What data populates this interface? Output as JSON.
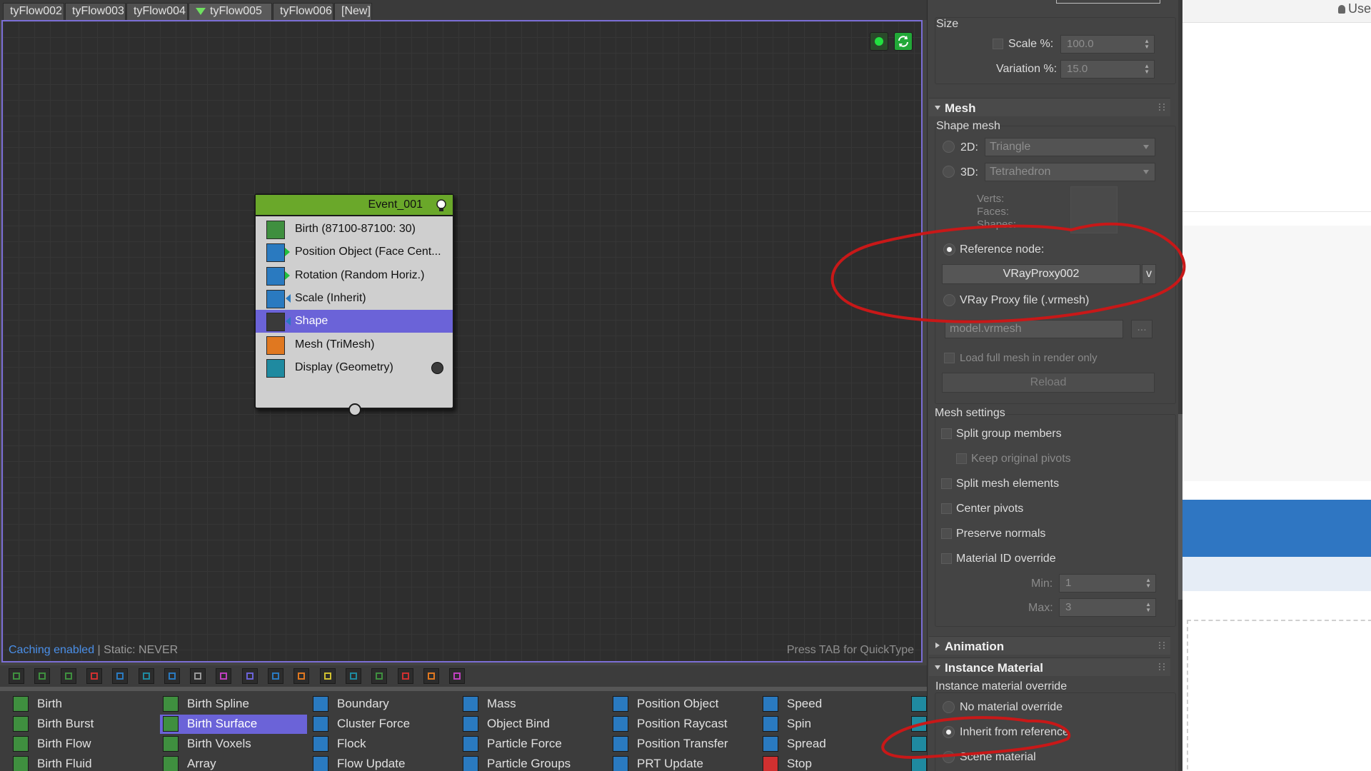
{
  "tabs": [
    {
      "label": "tyFlow002"
    },
    {
      "label": "tyFlow003"
    },
    {
      "label": "tyFlow004"
    },
    {
      "label": "tyFlow005",
      "active": true
    },
    {
      "label": "tyFlow006"
    },
    {
      "label": "[New]"
    }
  ],
  "graph": {
    "caching_label": "Caching enabled",
    "static_label": " | Static: NEVER",
    "quicktype_hint": "Press TAB for QuickType"
  },
  "event": {
    "title": "Event_001",
    "operators": [
      {
        "label": "Birth (87100-87100: 30)",
        "icon": "birth-icon",
        "color": "#3f8f3f"
      },
      {
        "label": "Position Object (Face Cent...",
        "icon": "position-object-icon",
        "color": "#2a7ac0"
      },
      {
        "label": "Rotation (Random Horiz.)",
        "icon": "rotation-icon",
        "color": "#2a7ac0"
      },
      {
        "label": "Scale (Inherit)",
        "icon": "scale-icon",
        "color": "#2a7ac0"
      },
      {
        "label": "Shape",
        "icon": "shape-icon",
        "color": "#3a3a3a",
        "selected": true
      },
      {
        "label": "Mesh (TriMesh)",
        "icon": "mesh-icon",
        "color": "#e07820"
      },
      {
        "label": "Display (Geometry)",
        "icon": "display-icon",
        "color": "#1f8aa0"
      }
    ]
  },
  "palette": {
    "columns": [
      [
        {
          "label": "Birth",
          "color": "#3f8f3f"
        },
        {
          "label": "Birth Burst",
          "color": "#3f8f3f"
        },
        {
          "label": "Birth Flow",
          "color": "#3f8f3f"
        },
        {
          "label": "Birth Fluid",
          "color": "#3f8f3f"
        }
      ],
      [
        {
          "label": "Birth Spline",
          "color": "#3f8f3f"
        },
        {
          "label": "Birth Surface",
          "color": "#3f8f3f",
          "selected": true
        },
        {
          "label": "Birth Voxels",
          "color": "#3f8f3f"
        },
        {
          "label": "Array",
          "color": "#3f8f3f"
        }
      ],
      [
        {
          "label": "Boundary",
          "color": "#2a7ac0"
        },
        {
          "label": "Cluster Force",
          "color": "#2a7ac0"
        },
        {
          "label": "Flock",
          "color": "#2a7ac0"
        },
        {
          "label": "Flow Update",
          "color": "#2a7ac0"
        }
      ],
      [
        {
          "label": "Mass",
          "color": "#2a7ac0"
        },
        {
          "label": "Object Bind",
          "color": "#2a7ac0"
        },
        {
          "label": "Particle Force",
          "color": "#2a7ac0"
        },
        {
          "label": "Particle Groups",
          "color": "#2a7ac0"
        }
      ],
      [
        {
          "label": "Position Object",
          "color": "#2a7ac0"
        },
        {
          "label": "Position Raycast",
          "color": "#2a7ac0"
        },
        {
          "label": "Position Transfer",
          "color": "#2a7ac0"
        },
        {
          "label": "PRT Update",
          "color": "#2a7ac0"
        }
      ],
      [
        {
          "label": "Speed",
          "color": "#2a7ac0"
        },
        {
          "label": "Spin",
          "color": "#2a7ac0"
        },
        {
          "label": "Spread",
          "color": "#2a7ac0"
        },
        {
          "label": "Stop",
          "color": "#d03030"
        }
      ]
    ],
    "toolbar_colors": [
      "#3f8f3f",
      "#3f8f3f",
      "#3f8f3f",
      "#d03030",
      "#2a7ac0",
      "#1f8aa0",
      "#2a7ac0",
      "#999999",
      "#c040c0",
      "#6b63d8",
      "#2a7ac0",
      "#e07820",
      "#d0c030",
      "#1f8aa0",
      "#3f8f3f",
      "#d03030",
      "#e07820",
      "#c040c0"
    ]
  },
  "props": {
    "size": {
      "title": "Size",
      "scale_label": "Scale %:",
      "scale_value": "100.0",
      "variation_label": "Variation %:",
      "variation_value": "15.0"
    },
    "mesh": {
      "title": "Mesh",
      "shape_mesh_label": "Shape mesh",
      "d2_label": "2D:",
      "d2_value": "Triangle",
      "d3_label": "3D:",
      "d3_value": "Tetrahedron",
      "verts_label": "Verts:",
      "faces_label": "Faces:",
      "shapes_label": "Shapes:",
      "reference_node_label": "Reference node:",
      "reference_node_value": "VRayProxy002",
      "reference_node_btn": "v",
      "vray_proxy_label": "VRay Proxy file (.vrmesh)",
      "vrmesh_value": "model.vrmesh",
      "browse_btn": "...",
      "load_full_label": "Load full mesh in render only",
      "reload_btn": "Reload"
    },
    "mesh_settings": {
      "title": "Mesh settings",
      "split_group": "Split group members",
      "keep_pivots": "Keep original pivots",
      "split_elements": "Split mesh elements",
      "center_pivots": "Center pivots",
      "preserve_normals": "Preserve normals",
      "matid_override": "Material ID override",
      "min_label": "Min:",
      "min_value": "1",
      "max_label": "Max:",
      "max_value": "3"
    },
    "animation": {
      "title": "Animation"
    },
    "instance_material": {
      "title": "Instance Material",
      "override_label": "Instance material override",
      "no_material": "No material override",
      "inherit": "Inherit from reference",
      "scene_material": "Scene material"
    }
  },
  "right_app": {
    "user_label": "Use"
  },
  "colors": {
    "accent": "#6b63d8",
    "event_header": "#6aa82a",
    "annotation": "#c81818"
  }
}
